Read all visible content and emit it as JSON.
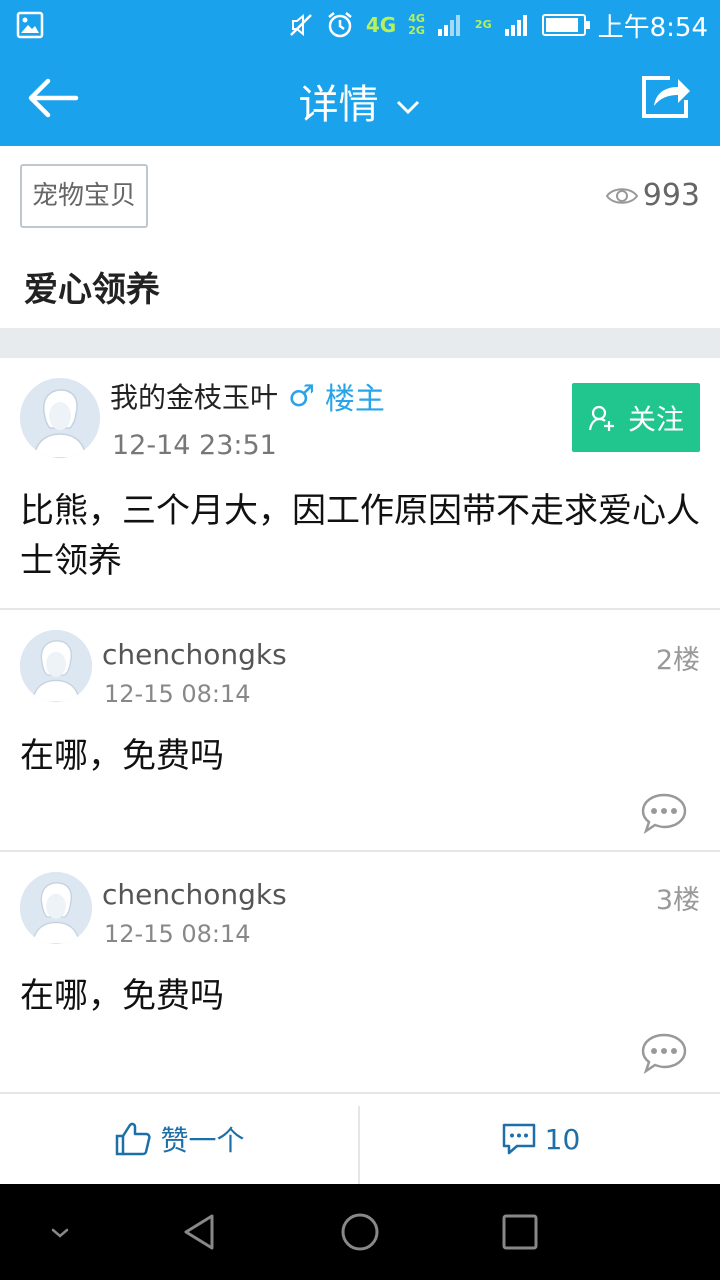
{
  "status_bar": {
    "time": "上午8:54",
    "network_main": "4G",
    "network_sub_top": "4G",
    "network_sub_bottom": "2G",
    "network_secondary": "2G",
    "battery_level": 0.9
  },
  "header": {
    "title": "详情"
  },
  "post": {
    "category": "宠物宝贝",
    "views": "993",
    "title": "爱心领养",
    "author": {
      "name": "我的金枝玉叶",
      "gender_symbol": "♂",
      "role": "楼主"
    },
    "date": "12-14 23:51",
    "follow_label": "关注",
    "body": "比熊，三个月大，因工作原因带不走求爱心人士领养"
  },
  "replies": [
    {
      "name": "chenchongks",
      "date": "12-15 08:14",
      "floor": "2楼",
      "body": "在哪，免费吗"
    },
    {
      "name": "chenchongks",
      "date": "12-15 08:14",
      "floor": "3楼",
      "body": "在哪，免费吗"
    }
  ],
  "actions": {
    "like_label": "赞一个",
    "comment_count": "10"
  },
  "colors": {
    "primary": "#1aa3ec",
    "follow_green": "#21c58e",
    "action_blue": "#1d6fa8"
  }
}
